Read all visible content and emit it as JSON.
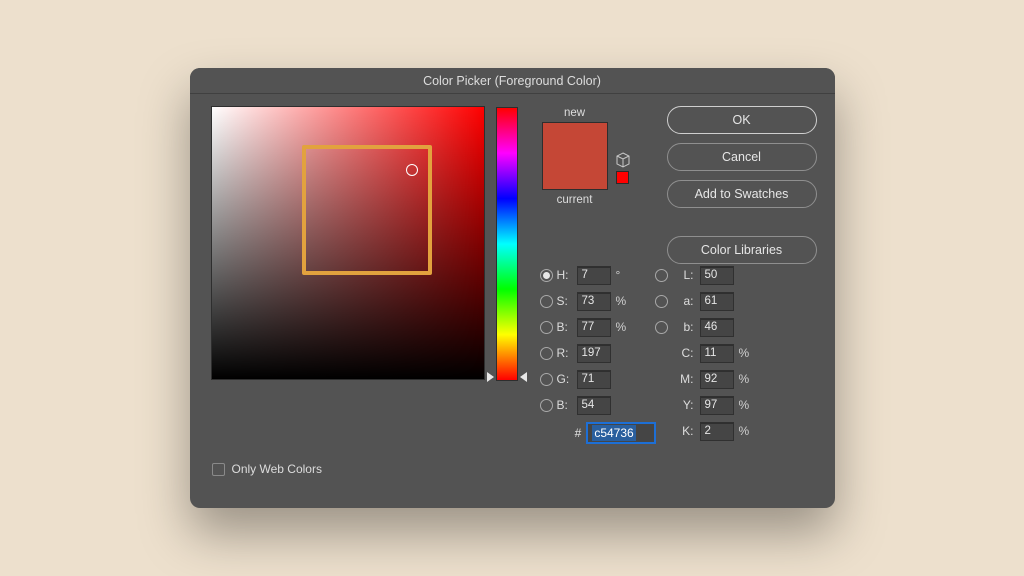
{
  "dialog": {
    "title": "Color Picker (Foreground Color)"
  },
  "preview": {
    "new_label": "new",
    "current_label": "current",
    "new_color": "#c54736",
    "current_color": "#c54736"
  },
  "buttons": {
    "ok": "OK",
    "cancel": "Cancel",
    "add_swatches": "Add to Swatches",
    "color_libraries": "Color Libraries"
  },
  "only_web_colors": {
    "label": "Only Web Colors",
    "checked": false
  },
  "hsb": {
    "h_label": "H:",
    "h_value": "7",
    "h_unit": "°",
    "s_label": "S:",
    "s_value": "73",
    "s_unit": "%",
    "b_label": "B:",
    "b_value": "77",
    "b_unit": "%",
    "selected": "H"
  },
  "lab": {
    "l_label": "L:",
    "l_value": "50",
    "a_label": "a:",
    "a_value": "61",
    "b_label": "b:",
    "b_value": "46"
  },
  "rgb": {
    "r_label": "R:",
    "r_value": "197",
    "g_label": "G:",
    "g_value": "71",
    "b_label": "B:",
    "b_value": "54"
  },
  "cmyk": {
    "c_label": "C:",
    "c_value": "11",
    "unit": "%",
    "m_label": "M:",
    "m_value": "92",
    "y_label": "Y:",
    "y_value": "97",
    "k_label": "K:",
    "k_value": "2"
  },
  "hex": {
    "hash": "#",
    "value": "c54736"
  }
}
